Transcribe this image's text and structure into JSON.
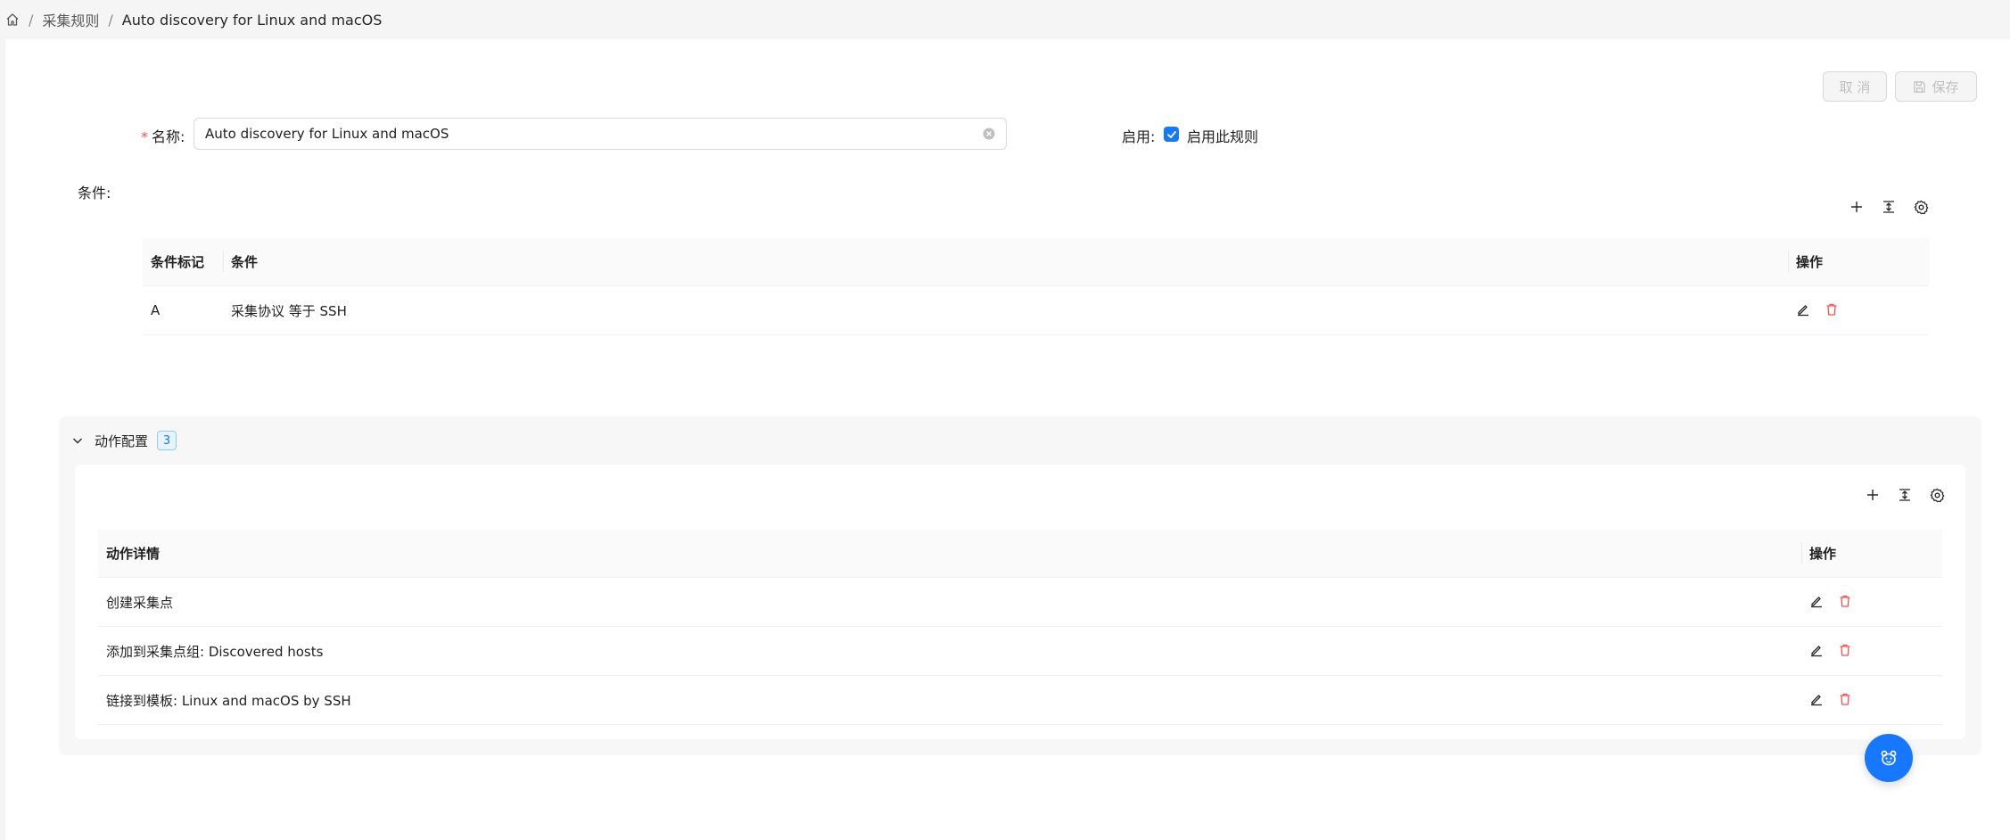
{
  "breadcrumb": {
    "items": [
      "采集规则",
      "Auto discovery for Linux and macOS"
    ],
    "separator": "/"
  },
  "header_buttons": {
    "cancel_label": "取 消",
    "save_label": "保存"
  },
  "form": {
    "name_label": "名称:",
    "name_value": "Auto discovery for Linux and macOS",
    "enable_label": "启用:",
    "enable_checkbox_label": "启用此规则",
    "enable_checked": true,
    "conditions_label": "条件:"
  },
  "conditions_table": {
    "columns": [
      "条件标记",
      "条件",
      "操作"
    ],
    "rows": [
      {
        "tag": "A",
        "condition": "采集协议 等于 SSH"
      }
    ]
  },
  "actions_section": {
    "title": "动作配置",
    "count": "3",
    "columns": [
      "动作详情",
      "操作"
    ],
    "rows": [
      {
        "detail": "创建采集点"
      },
      {
        "detail": "添加到采集点组: Discovered hosts"
      },
      {
        "detail": "链接到模板: Linux and macOS by SSH"
      }
    ]
  },
  "colors": {
    "accent": "#1677ff",
    "danger": "#ff4d4f",
    "required": "#ff4d4f"
  },
  "icons": [
    "home-icon",
    "clear-icon",
    "check-icon",
    "plus-icon",
    "column-height-icon",
    "gear-icon",
    "edit-icon",
    "delete-icon",
    "chevron-down-icon",
    "save-icon",
    "robot-icon"
  ]
}
